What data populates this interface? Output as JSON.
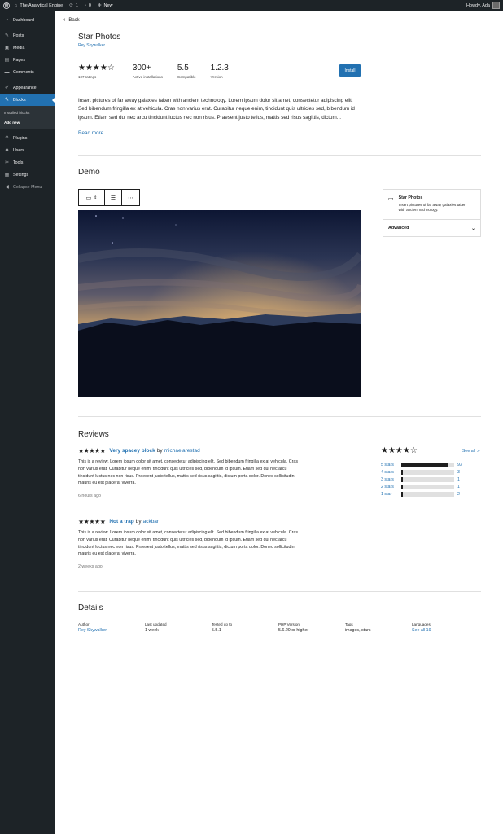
{
  "adminbar": {
    "site_name": "The Analytical Engine",
    "updates_count": "1",
    "comments_count": "0",
    "new_label": "New",
    "howdy": "Howdy, Ada"
  },
  "sidebar": {
    "items": [
      {
        "label": "Dashboard",
        "icon": "dashboard-icon"
      },
      {
        "label": "Posts",
        "icon": "pin-icon"
      },
      {
        "label": "Media",
        "icon": "media-icon"
      },
      {
        "label": "Pages",
        "icon": "pages-icon"
      },
      {
        "label": "Comments",
        "icon": "comment-icon"
      },
      {
        "label": "Appearance",
        "icon": "brush-icon"
      },
      {
        "label": "Blocks",
        "icon": "pin-icon"
      },
      {
        "label": "Plugins",
        "icon": "plugin-icon"
      },
      {
        "label": "Users",
        "icon": "user-icon"
      },
      {
        "label": "Tools",
        "icon": "wrench-icon"
      },
      {
        "label": "Settings",
        "icon": "settings-icon"
      },
      {
        "label": "Collapse Menu",
        "icon": "collapse-icon"
      }
    ],
    "submenu": [
      "Installed blocks",
      "Add new"
    ]
  },
  "header": {
    "back_label": "Back",
    "title": "Star Photos",
    "author": "Rey Skywalker"
  },
  "stats": {
    "rating_stars": 4,
    "ratings_count": "107 ratings",
    "installs_value": "300+",
    "installs_label": "Active installations",
    "compatible_value": "5.5",
    "compatible_label": "Compatible",
    "version_value": "1.2.3",
    "version_label": "Version",
    "install_button": "Install"
  },
  "description": {
    "text": "Insert pictures of far away galaxies taken with ancient technology.  Lorem ipsum dolor sit amet, consectetur adipiscing elit. Sed bibendum fringilla ex at vehicula. Cras non varius erat. Curabitur neque enim, tincidunt quis ultricies sed, bibendum id ipsum. Etiam sed dui nec arcu tincidunt luctus nec non risus. Praesent justo tellus, mattis sed risus sagittis, dictum...",
    "read_more": "Read more"
  },
  "demo": {
    "heading": "Demo",
    "panel_title": "Star Photos",
    "panel_desc": "Insert pictures of far away galaxies taken with ancient technology.",
    "panel_advanced": "Advanced",
    "more_label": "⋯"
  },
  "reviews": {
    "heading": "Reviews",
    "items": [
      {
        "stars": 5,
        "title": "Very spacey block",
        "by": "by",
        "author": "michaelarestad",
        "body": "This is a review. Lorem ipsum dolor sit amet, consectetur adipiscing elit. Sed bibendum fringilla ex at vehicula. Cras non varius erat. Curabitur neque enim, tincidunt quis ultricies sed, bibendum id ipsum. Etiam sed dui nec arcu tincidunt luctus nec non risus. Praesent justo tellus, mattis sed risus sagittis, dictum porta dolor. Donec sollicitudin mauris eu est placerat viverra.",
        "time": "6 hours ago"
      },
      {
        "stars": 5,
        "title": "Not a trap",
        "by": "by",
        "author": "ackbar",
        "body": "This is a review. Lorem ipsum dolor sit amet, consectetur adipiscing elit. Sed bibendum fringilla ex at vehicula. Cras non varius erat. Curabitur neque enim, tincidunt quis ultricies sed, bibendum id ipsum. Etiam sed dui nec arcu tincidunt luctus nec non risus. Praesent justo tellus, mattis sed risus sagittis, dictum porta dolor. Donec sollicitudin mauris eu est placerat viverra.",
        "time": "2 weeks ago"
      }
    ],
    "summary": {
      "stars": 4,
      "see_all": "See all",
      "rows": [
        {
          "label": "5 stars",
          "count": "93",
          "fraction": 0.87
        },
        {
          "label": "4 stars",
          "count": "3",
          "fraction": 0.03
        },
        {
          "label": "3 stars",
          "count": "1",
          "fraction": 0.01
        },
        {
          "label": "2 stars",
          "count": "1",
          "fraction": 0.01
        },
        {
          "label": "1 star",
          "count": "2",
          "fraction": 0.02
        }
      ]
    }
  },
  "details": {
    "heading": "Details",
    "author_label": "Author",
    "author_value": "Rey Skywalker",
    "updated_label": "Last updated",
    "updated_value": "1 week",
    "tested_label": "Tested up to",
    "tested_value": "5.5.1",
    "php_label": "PHP Version",
    "php_value": "5.6.20 or higher",
    "tags_label": "Tags",
    "tags_value": "images, stars",
    "languages_label": "Languages",
    "languages_value": "See all 19"
  },
  "colors": {
    "accent": "#2271b1",
    "admin_dark": "#1d2327"
  }
}
